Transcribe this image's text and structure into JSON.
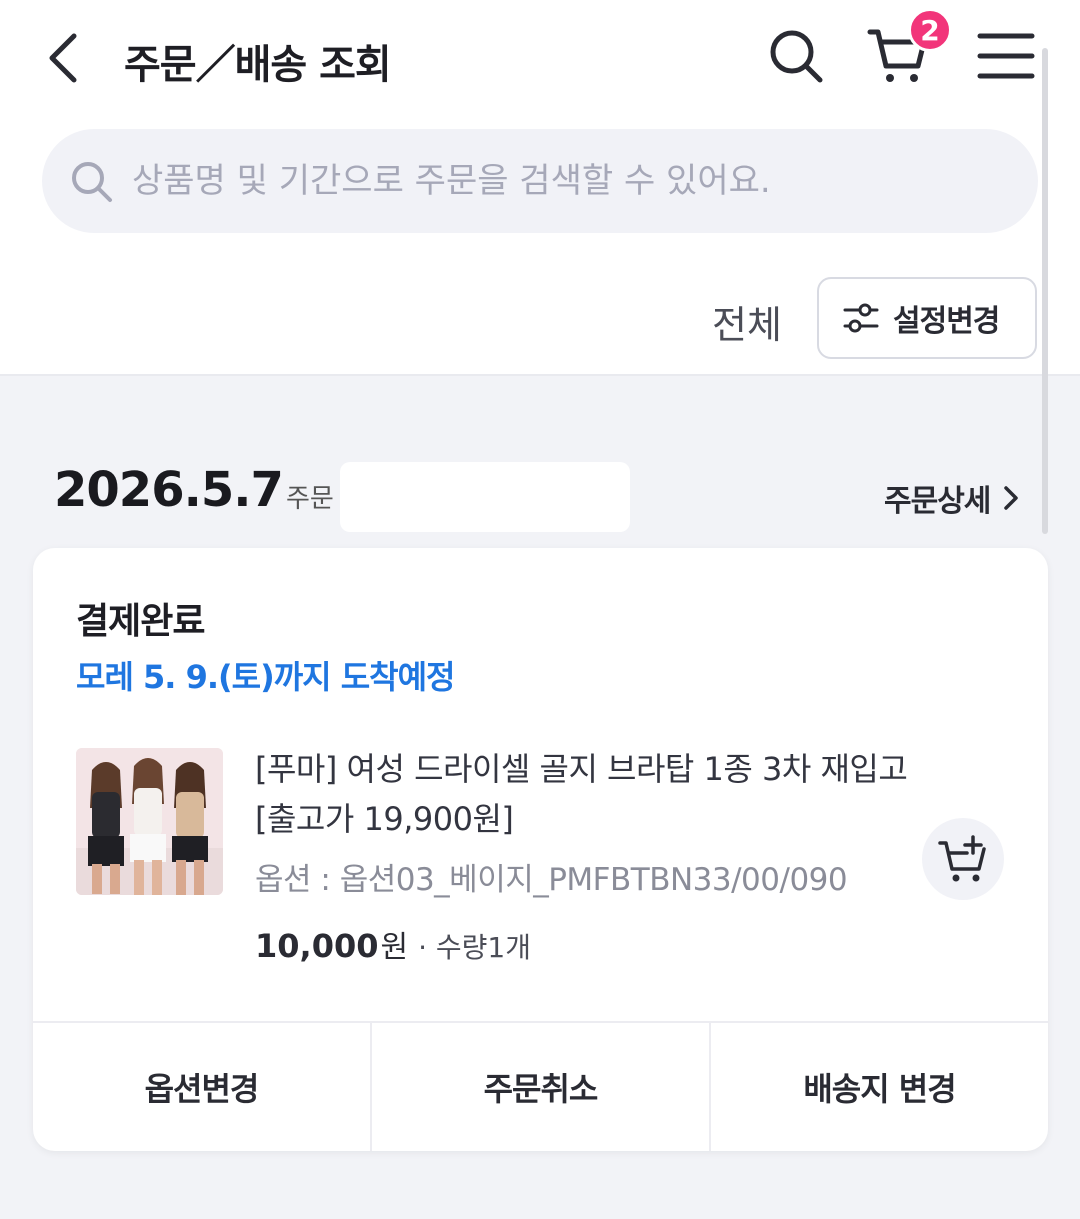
{
  "header": {
    "title": "주문／배송 조회",
    "cart_count": "2"
  },
  "search": {
    "placeholder": "상품명 및 기간으로 주문을 검색할 수 있어요."
  },
  "filter": {
    "current": "전체",
    "settings_label": "설정변경"
  },
  "order": {
    "date": "2026.5.7",
    "number_label": "주문",
    "detail_label": "주문상세",
    "status": "결제완료",
    "eta": "모레 5. 9.(토)까지 도착예정",
    "product": {
      "name": "[푸마] 여성 드라이셀 골지 브라탑 1종 3차 재입고[출고가 19,900원]",
      "option": "옵션 : 옵션03_베이지_PMFBTBN33/00/090",
      "price": "10,000",
      "price_unit": "원",
      "quantity": "· 수량1개"
    },
    "actions": [
      "옵션변경",
      "주문취소",
      "배송지 변경"
    ]
  },
  "colors": {
    "accent_blue": "#1f76e0",
    "badge_pink": "#f2357a"
  },
  "icons": [
    "back-arrow-icon",
    "search-icon",
    "cart-icon",
    "menu-icon",
    "settings-sliders-icon",
    "chevron-right-icon",
    "add-to-cart-icon"
  ]
}
